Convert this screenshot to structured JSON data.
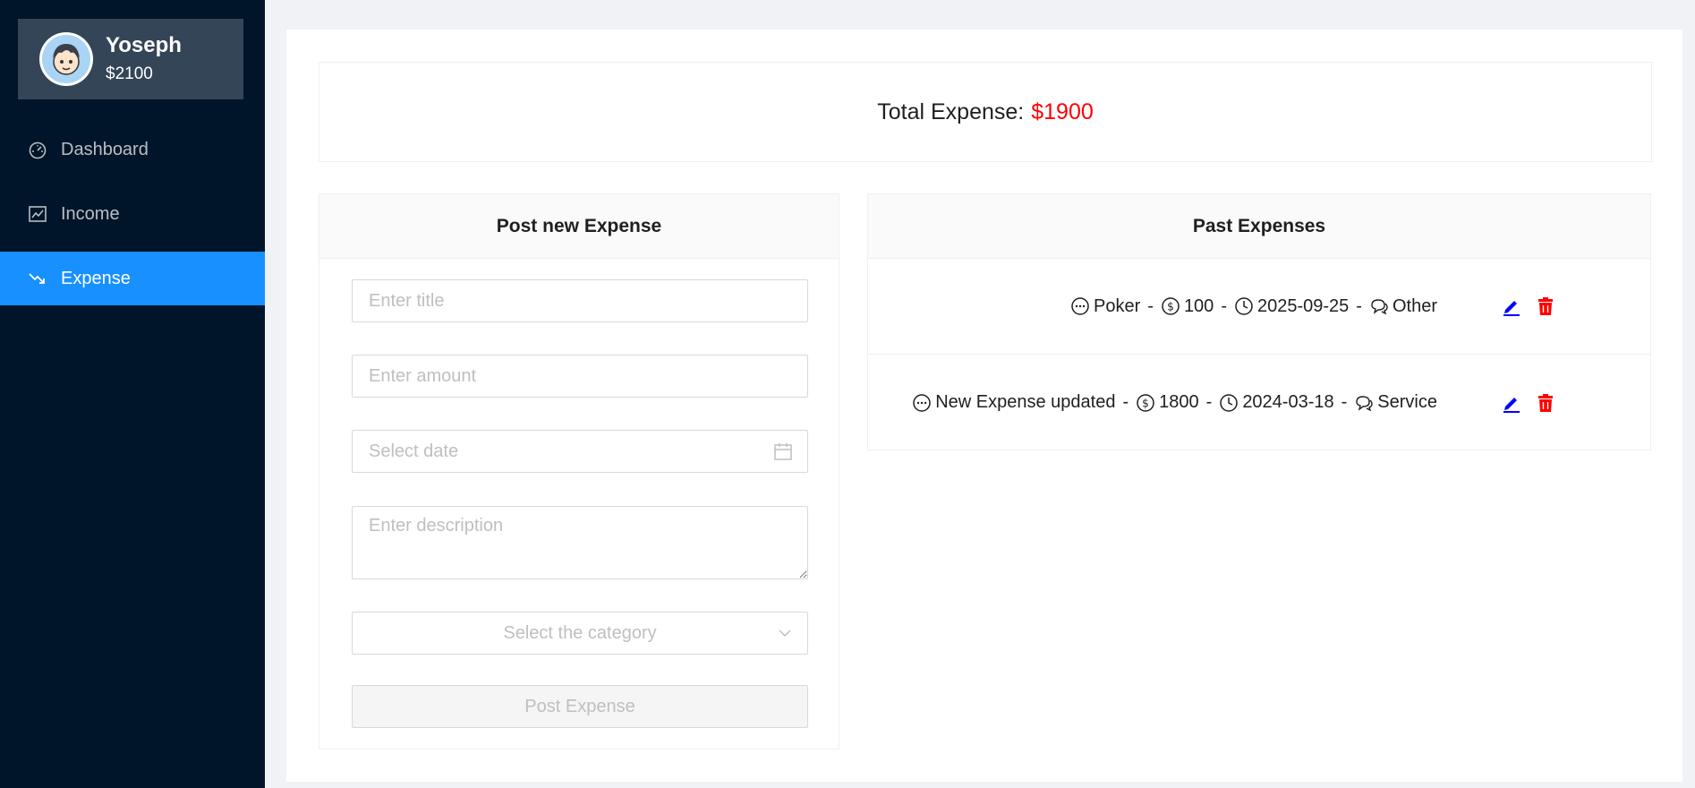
{
  "user": {
    "name": "Yoseph",
    "balance": "$2100"
  },
  "menu": [
    {
      "label": "Dashboard",
      "icon": "dashboard-icon"
    },
    {
      "label": "Income",
      "icon": "line-chart-icon"
    },
    {
      "label": "Expense",
      "icon": "fall-icon"
    }
  ],
  "total": {
    "label": "Total Expense:",
    "amount": "$1900"
  },
  "form": {
    "heading": "Post new Expense",
    "title_placeholder": "Enter title",
    "amount_placeholder": "Enter amount",
    "date_placeholder": "Select date",
    "description_placeholder": "Enter description",
    "category_placeholder": "Select the category",
    "submit_label": "Post Expense"
  },
  "past": {
    "heading": "Past Expenses",
    "items": [
      {
        "title": "Poker",
        "amount": "100",
        "date": "2025-09-25",
        "category": "Other"
      },
      {
        "title": "New Expense updated",
        "amount": "1800",
        "date": "2024-03-18",
        "category": "Service"
      }
    ]
  },
  "colors": {
    "sidebar": "#001529",
    "accent": "#1890ff",
    "danger": "#ff0000",
    "edit": "#0000ff"
  }
}
